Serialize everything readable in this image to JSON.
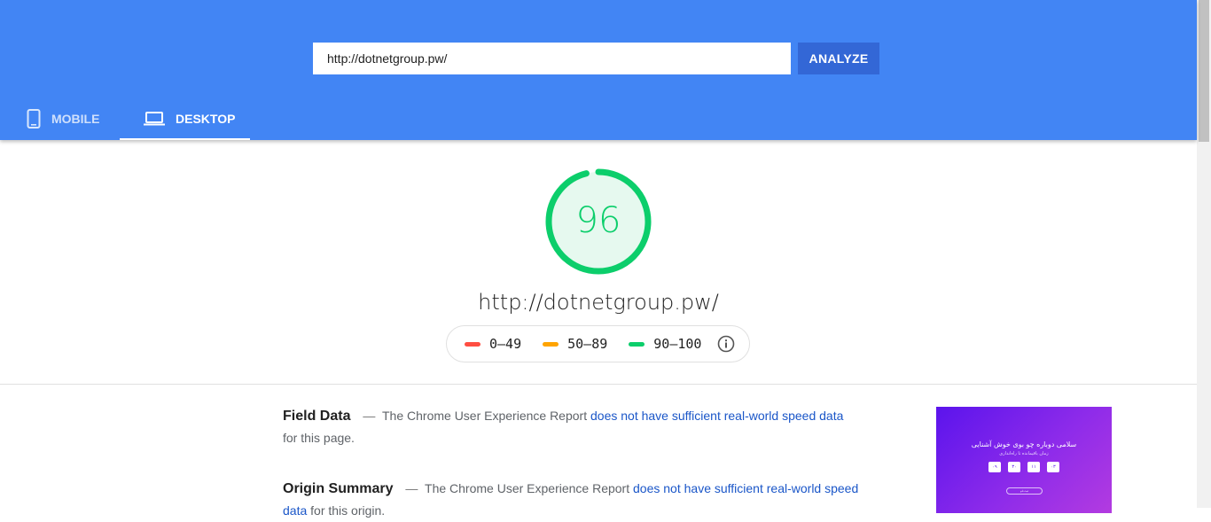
{
  "header": {
    "url_value": "http://dotnetgroup.pw/",
    "analyze_label": "ANALYZE",
    "accent": "#4285f4",
    "button_color": "#3367d6"
  },
  "tabs": [
    {
      "label": "MOBILE",
      "icon": "smartphone-icon",
      "active": false
    },
    {
      "label": "DESKTOP",
      "icon": "laptop-icon",
      "active": true
    }
  ],
  "report": {
    "score": "96",
    "score_fraction": 0.96,
    "score_color": "#0cce6b",
    "url": "http://dotnetgroup.pw/",
    "legend": [
      {
        "label": "0–49",
        "color": "#ff4e42"
      },
      {
        "label": "50–89",
        "color": "#ffa400"
      },
      {
        "label": "90–100",
        "color": "#0cce6b"
      }
    ],
    "info_icon": "info-icon"
  },
  "field_data": {
    "title": "Field Data",
    "dash": "—",
    "prefix": "The Chrome User Experience Report",
    "link": "does not have sufficient real-world speed data",
    "suffix": "for this page."
  },
  "origin_summary": {
    "title": "Origin Summary",
    "dash": "—",
    "prefix": "The Chrome User Experience Report",
    "link": "does not have sufficient real-world speed data",
    "suffix": "for this origin."
  },
  "thumbnail": {
    "title": "سلامی دوباره چو بوی خوش آشنایی",
    "subtitle": "زمان باقیمانده تا راه‌اندازی",
    "boxes": [
      "۰۹",
      "۳۰",
      "۱۱",
      "۰۳"
    ],
    "button": "ثبت نام"
  }
}
